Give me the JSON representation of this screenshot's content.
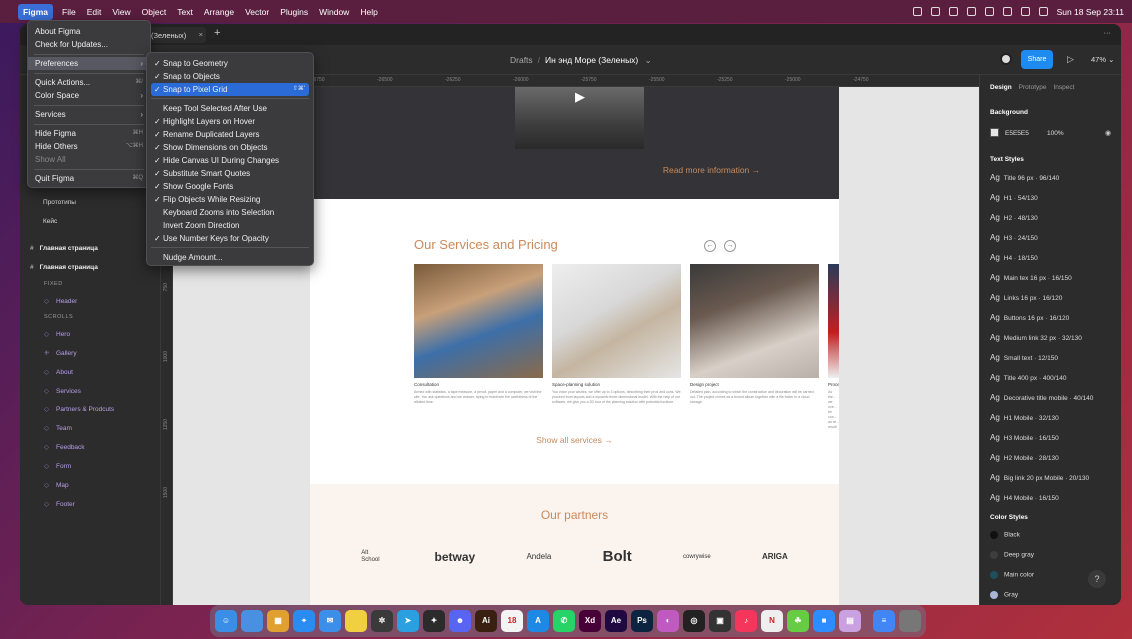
{
  "menubar": {
    "items": [
      "Figma",
      "File",
      "Edit",
      "View",
      "Object",
      "Text",
      "Arrange",
      "Vector",
      "Plugins",
      "Window",
      "Help"
    ],
    "clock": "Sun 18 Sep 23:11",
    "icons": [
      "wifi-icon",
      "search-icon",
      "control-center-icon",
      "battery-icon",
      "bluetooth-icon",
      "volume-icon",
      "info-icon",
      "display-icon"
    ]
  },
  "tab": {
    "title": "(Зеленых)",
    "close": "×",
    "plus": "+",
    "more": "···"
  },
  "toolbar": {
    "drafts": "Drafts",
    "sep": "/",
    "file": "Ин энд Море (Зеленых)",
    "chevron": "⌄",
    "share": "Share",
    "play": "▷",
    "zoom": "47% ⌄"
  },
  "ruler": {
    "top": [
      "-26750",
      "-26500",
      "-26250",
      "-26000",
      "-25750",
      "-25500",
      "-25250",
      "-25000",
      "-24750"
    ],
    "left": [
      "250",
      "500",
      "750",
      "1000",
      "1250",
      "1500"
    ]
  },
  "left_panel": {
    "pages": [
      "Прототипы",
      "Кейс"
    ],
    "frames": [
      "Главная страница",
      "Главная страница"
    ],
    "fixed_label": "FIXED",
    "scrolls_label": "SCROLLS",
    "fixed_layers": [
      "Header"
    ],
    "scroll_layers": [
      "Hero",
      "Gallery",
      "About",
      "Services",
      "Partners & Prodcuts",
      "Team",
      "Feedback",
      "Form",
      "Map",
      "Footer"
    ]
  },
  "canvas": {
    "read_more": "Read more information →",
    "services_title": "Our Services and Pricing",
    "prev": "←",
    "next": "→",
    "cards": [
      {
        "caption": "Consultation",
        "desc": "Armed with statistics, a tape measure, a pencil, paper and a computer, we visit the site. You ask questions and we answer, trying to maximize the usefulness of the allotted time."
      },
      {
        "caption": "Space-planning solution",
        "desc": "You voice your wishes, we offer up to 3 options, describing their pros and cons. We proceed from layouts and a dynamic three-dimensional model. With the help of our software, we give you a 3D tour of the planning solution with potential furniture."
      },
      {
        "caption": "Design project",
        "desc": "Detailed plan, according to which the construction and decoration will be carried out. The project comes as a bound album together with a file folder in a cloud storage."
      },
      {
        "caption": "Proce",
        "desc": "As the... we ove... be con... an ar... result"
      }
    ],
    "show_all": "Show all services →",
    "partners_title": "Our partners",
    "partners": [
      "Alt School",
      "betway",
      "Andela",
      "Bolt",
      "cowrywise",
      "ARIGA"
    ]
  },
  "right_panel": {
    "tabs": [
      "Design",
      "Prototype",
      "Inspect"
    ],
    "background_label": "Background",
    "bg_hex": "E5E5E5",
    "bg_opacity": "100%",
    "text_styles_label": "Text Styles",
    "ag": "Ag",
    "text_styles": [
      "Title 96 px · 96/140",
      "H1 · 54/130",
      "H2 · 48/130",
      "H3 · 24/150",
      "H4 · 18/150",
      "Main tex 16 px · 16/150",
      "Links 16 px · 16/120",
      "Buttons 16 px · 16/120",
      "Medium link 32 px · 32/130",
      "Small text · 12/150",
      "Title 400 px · 400/140",
      "Decorative title mobile · 40/140",
      "H1 Mobile · 32/130",
      "H3 Mobile · 16/150",
      "H2 Mobile · 28/130",
      "Big link 20 px Mobile · 20/130",
      "H4 Mobile · 16/150"
    ],
    "color_styles_label": "Color Styles",
    "color_styles": [
      {
        "name": "Black",
        "color": "#111111"
      },
      {
        "name": "Deep gray",
        "color": "#3d3d3d"
      },
      {
        "name": "Main color",
        "color": "#1f4f5a"
      },
      {
        "name": "Gray",
        "color": "#a9b6d9"
      }
    ],
    "help": "?"
  },
  "app_menu": {
    "items": [
      {
        "label": "About Figma",
        "shortcut": ""
      },
      {
        "label": "Check for Updates...",
        "shortcut": ""
      },
      {
        "label": "Preferences",
        "shortcut": "›"
      },
      {
        "label": "Quick Actions...",
        "shortcut": "⌘/"
      },
      {
        "label": "Color Space",
        "shortcut": "›"
      },
      {
        "label": "Services",
        "shortcut": "›"
      },
      {
        "label": "Hide Figma",
        "shortcut": "⌘H"
      },
      {
        "label": "Hide Others",
        "shortcut": "⌥⌘H"
      },
      {
        "label": "Show All",
        "shortcut": ""
      },
      {
        "label": "Quit Figma",
        "shortcut": "⌘Q"
      }
    ]
  },
  "prefs_menu": {
    "check": "✓",
    "items": [
      {
        "label": "Snap to Geometry",
        "checked": true
      },
      {
        "label": "Snap to Objects",
        "checked": true
      },
      {
        "label": "Snap to Pixel Grid",
        "checked": true,
        "shortcut": "⇧⌘'"
      },
      {
        "label": "Keep Tool Selected After Use",
        "checked": false
      },
      {
        "label": "Highlight Layers on Hover",
        "checked": true
      },
      {
        "label": "Rename Duplicated Layers",
        "checked": true
      },
      {
        "label": "Show Dimensions on Objects",
        "checked": true
      },
      {
        "label": "Hide Canvas UI During Changes",
        "checked": true
      },
      {
        "label": "Substitute Smart Quotes",
        "checked": true
      },
      {
        "label": "Show Google Fonts",
        "checked": true
      },
      {
        "label": "Flip Objects While Resizing",
        "checked": true
      },
      {
        "label": "Keyboard Zooms into Selection",
        "checked": false
      },
      {
        "label": "Invert Zoom Direction",
        "checked": false
      },
      {
        "label": "Use Number Keys for Opacity",
        "checked": true
      },
      {
        "label": "Nudge Amount...",
        "checked": false
      }
    ]
  },
  "dock": {
    "apps": [
      {
        "name": "finder",
        "label": "☺",
        "color": "#3a8ee6"
      },
      {
        "name": "launchpad",
        "label": "",
        "color": "#4a90e2"
      },
      {
        "name": "launchpad-grid",
        "label": "▦",
        "color": "#e0a030"
      },
      {
        "name": "safari",
        "label": "⌖",
        "color": "#2a8bf0"
      },
      {
        "name": "mail",
        "label": "✉",
        "color": "#3b8fe8"
      },
      {
        "name": "notes",
        "label": "",
        "color": "#f0d040"
      },
      {
        "name": "figma-plugin",
        "label": "✲",
        "color": "#3a3a3a"
      },
      {
        "name": "telegram",
        "label": "➤",
        "color": "#2aa0e0"
      },
      {
        "name": "figma",
        "label": "✦",
        "color": "#2b2b2b"
      },
      {
        "name": "discord",
        "label": "☻",
        "color": "#5865f2"
      },
      {
        "name": "illustrator",
        "label": "Ai",
        "color": "#3a2010"
      },
      {
        "name": "calendar",
        "label": "18",
        "color": "#f4f4f4"
      },
      {
        "name": "app-store",
        "label": "A",
        "color": "#1e88e5"
      },
      {
        "name": "whatsapp",
        "label": "✆",
        "color": "#25d366"
      },
      {
        "name": "xd",
        "label": "Xd",
        "color": "#470137"
      },
      {
        "name": "after-effects",
        "label": "Ae",
        "color": "#1f0940"
      },
      {
        "name": "photoshop",
        "label": "Ps",
        "color": "#0c2440"
      },
      {
        "name": "colorsync",
        "label": "◐",
        "color": "#c05ac0"
      },
      {
        "name": "chatgpt",
        "label": "◎",
        "color": "#222"
      },
      {
        "name": "controls",
        "label": "▣",
        "color": "#333"
      },
      {
        "name": "music",
        "label": "♪",
        "color": "#f5365c"
      },
      {
        "name": "notion",
        "label": "N",
        "color": "#eee"
      },
      {
        "name": "game",
        "label": "☘",
        "color": "#6c4"
      },
      {
        "name": "zoom",
        "label": "■",
        "color": "#2d8cff"
      },
      {
        "name": "preview",
        "label": "▤",
        "color": "#c9a0e0"
      },
      {
        "name": "docs",
        "label": "≡",
        "color": "#4285f4"
      },
      {
        "name": "trash",
        "label": "",
        "color": "#777"
      }
    ]
  }
}
